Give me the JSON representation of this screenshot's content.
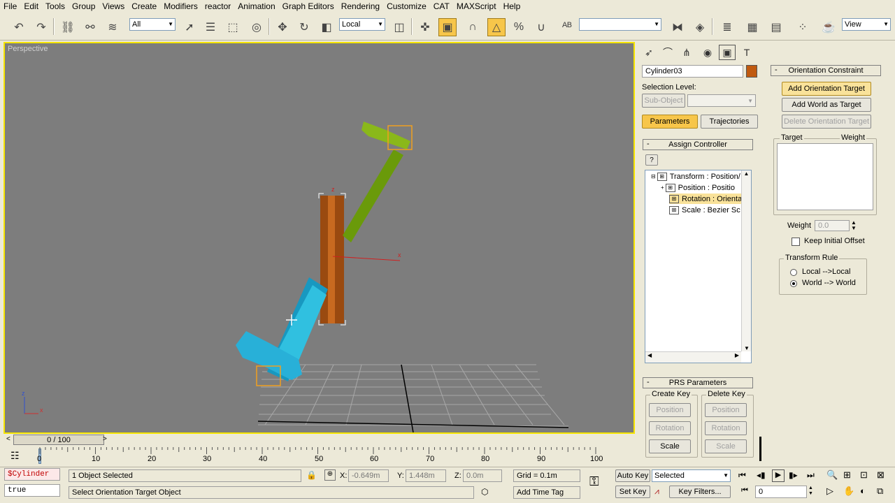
{
  "menu": [
    "File",
    "Edit",
    "Tools",
    "Group",
    "Views",
    "Create",
    "Modifiers",
    "reactor",
    "Animation",
    "Graph Editors",
    "Rendering",
    "Customize",
    "CAT",
    "MAXScript",
    "Help"
  ],
  "toolbar": {
    "selection_filter": "All",
    "reference_coord": "Local",
    "named_selection": "",
    "view_combo": "View",
    "icons": [
      "undo-icon",
      "redo-icon",
      "select-link-icon",
      "unlink-icon",
      "bind-space-warp-icon",
      "select-object-icon",
      "select-by-name-icon",
      "rect-selection-icon",
      "window-crossing-icon",
      "move-icon",
      "rotate-icon",
      "scale-icon",
      "pivot-center-icon",
      "select-manipulate-icon",
      "keyboard-shortcut-icon",
      "snap-toggle-icon",
      "angle-snap-icon",
      "percent-snap-icon",
      "spinner-snap-icon",
      "edit-named-selection-icon",
      "mirror-icon",
      "align-icon",
      "layer-manager-icon",
      "curve-editor-icon",
      "schematic-view-icon",
      "material-editor-icon",
      "render-setup-icon"
    ]
  },
  "viewport": {
    "label": "Perspective",
    "axis_labels": {
      "z": "z",
      "x": "x"
    }
  },
  "command_panel": {
    "object_name": "Cylinder03",
    "object_color": "#c05a10",
    "selection_level_label": "Selection Level:",
    "sub_object": "Sub-Object",
    "parameters_btn": "Parameters",
    "trajectories_btn": "Trajectories",
    "assign_controller": {
      "title": "Assign Controller",
      "help": "?",
      "tree": [
        {
          "label": "Transform : Position/",
          "selected": false
        },
        {
          "label": "Position : Positio",
          "selected": false
        },
        {
          "label": "Rotation : Orienta",
          "selected": true
        },
        {
          "label": "Scale : Bezier Sc",
          "selected": false
        }
      ]
    },
    "prs": {
      "title": "PRS Parameters",
      "create_key": "Create Key",
      "delete_key": "Delete Key",
      "position": "Position",
      "rotation": "Rotation",
      "scale": "Scale"
    },
    "orientation": {
      "title": "Orientation Constraint",
      "add_target": "Add Orientation Target",
      "add_world": "Add World as Target",
      "delete_target": "Delete Orientation Target",
      "target_col": "Target",
      "weight_col": "Weight",
      "weight_label": "Weight",
      "weight_value": "0.0",
      "keep_offset": "Keep Initial Offset",
      "transform_rule": "Transform Rule",
      "local_local": "Local -->Local",
      "world_world": "World --> World"
    }
  },
  "timeline": {
    "frame": "0 / 100",
    "ticks": [
      "0",
      "10",
      "20",
      "30",
      "40",
      "50",
      "60",
      "70",
      "80",
      "90",
      "100"
    ]
  },
  "status": {
    "script_line1": "$Cylinder",
    "script_line2": "true",
    "selected": "1 Object Selected",
    "prompt": "Select Orientation Target Object",
    "x_label": "X:",
    "x_value": "-0.649m",
    "y_label": "Y:",
    "y_value": "1.448m",
    "z_label": "Z:",
    "z_value": "0.0m",
    "grid": "Grid = 0.1m",
    "add_time_tag": "Add Time Tag",
    "auto_key": "Auto Key",
    "set_key": "Set Key",
    "selected_combo": "Selected",
    "key_filters": "Key Filters...",
    "frame_value": "0"
  }
}
